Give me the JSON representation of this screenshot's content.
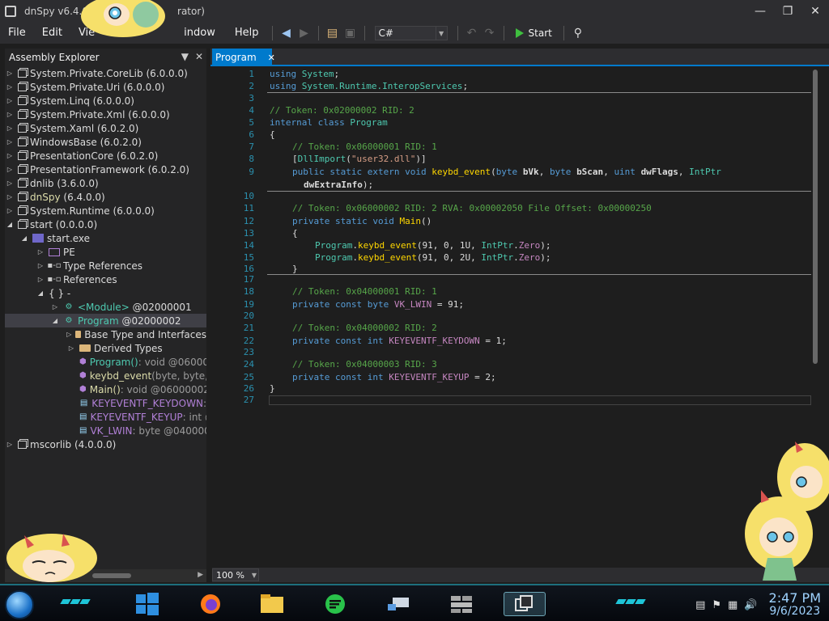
{
  "window": {
    "title_prefix": "dnSpy v6.4.0",
    "title_suffix": "rator)"
  },
  "menu": {
    "file": "File",
    "edit": "Edit",
    "view": "Vie",
    "window": "indow",
    "help": "Help"
  },
  "toolbar": {
    "language": "C#",
    "start_label": "Start"
  },
  "explorer": {
    "title": "Assembly Explorer",
    "tree": {
      "r1": {
        "name": "System.Private.CoreLib",
        "ver": "(6.0.0.0)"
      },
      "r2": {
        "name": "System.Private.Uri",
        "ver": "(6.0.0.0)"
      },
      "r3": {
        "name": "System.Linq",
        "ver": "(6.0.0.0)"
      },
      "r4": {
        "name": "System.Private.Xml",
        "ver": "(6.0.0.0)"
      },
      "r5": {
        "name": "System.Xaml",
        "ver": "(6.0.2.0)"
      },
      "r6": {
        "name": "WindowsBase",
        "ver": "(6.0.2.0)"
      },
      "r7": {
        "name": "PresentationCore",
        "ver": "(6.0.2.0)"
      },
      "r8": {
        "name": "PresentationFramework",
        "ver": "(6.0.2.0)"
      },
      "r9": {
        "name": "dnlib",
        "ver": "(3.6.0.0)"
      },
      "r10": {
        "name": "dnSpy",
        "ver": "(6.4.0.0)"
      },
      "r11": {
        "name": "System.Runtime",
        "ver": "(6.0.0.0)"
      },
      "r12": {
        "name": "start",
        "ver": "(0.0.0.0)"
      },
      "r13": {
        "name": "start.exe"
      },
      "r14": {
        "name": "PE"
      },
      "r15": {
        "name": "Type References"
      },
      "r16": {
        "name": "References"
      },
      "r17": {
        "name": "{ } -"
      },
      "r18": {
        "name": "<Module>",
        "ver": "@02000001"
      },
      "r19": {
        "name": "Program",
        "ver": "@02000002"
      },
      "r20": {
        "name": "Base Type and Interfaces"
      },
      "r21": {
        "name": "Derived Types"
      },
      "r22": {
        "name": "Program()",
        "ver": " : void @060000"
      },
      "r23": {
        "name": "keybd_event",
        "ver": "(byte, byte, u"
      },
      "r24": {
        "name": "Main()",
        "ver": " : void @06000002"
      },
      "r25": {
        "name": "KEYEVENTF_KEYDOWN",
        "ver": " :"
      },
      "r26": {
        "name": "KEYEVENTF_KEYUP",
        "ver": " : int @"
      },
      "r27": {
        "name": "VK_LWIN",
        "ver": " : byte @0400000"
      },
      "r28": {
        "name": "mscorlib",
        "ver": "(4.0.0.0)"
      }
    }
  },
  "editor": {
    "tab_label": "Program",
    "zoom": "100 %",
    "line_numbers": [
      "1",
      "2",
      "3",
      "4",
      "5",
      "6",
      "7",
      "8",
      "9",
      "10",
      "11",
      "12",
      "13",
      "14",
      "15",
      "16",
      "17",
      "18",
      "19",
      "20",
      "21",
      "22",
      "23",
      "24",
      "25",
      "26",
      "27"
    ],
    "code": {
      "l1_kw": "using",
      "l1_ns": "System",
      "l2_kw": "using",
      "l2_ns": "System.Runtime.InteropServices",
      "l4": "// Token: 0x02000002 RID: 2",
      "l5_kw": "internal class",
      "l5_name": "Program",
      "l6": "{",
      "l7": "// Token: 0x06000001 RID: 1",
      "l8_attr": "DllImport",
      "l8_str": "\"user32.dll\"",
      "l9_kw": "public static extern void",
      "l9_name": "keybd_event",
      "l9_t1": "byte",
      "l9_p1": "bVk",
      "l9_t2": "byte",
      "l9_p2": "bScan",
      "l9_t3": "uint",
      "l9_p3": "dwFlags",
      "l9_t4": "IntPtr",
      "l9b": "dwExtraInfo",
      "l11": "// Token: 0x06000002 RID: 2 RVA: 0x00002050 File Offset: 0x00000250",
      "l12_kw": "private static void",
      "l12_name": "Main",
      "l13": "{",
      "l14_cls": "Program",
      "l14_m": "keybd_event",
      "l14_args": "(91, 0, 1U, ",
      "l14_t": "IntPtr",
      "l14_z": "Zero",
      "l15_cls": "Program",
      "l15_m": "keybd_event",
      "l15_args": "(91, 0, 2U, ",
      "l15_t": "IntPtr",
      "l15_z": "Zero",
      "l16": "}",
      "l18": "// Token: 0x04000001 RID: 1",
      "l19_kw": "private const byte",
      "l19_name": "VK_LWIN",
      "l19_val": " = 91;",
      "l21": "// Token: 0x04000002 RID: 2",
      "l22_kw": "private const int",
      "l22_name": "KEYEVENTF_KEYDOWN",
      "l22_val": " = 1;",
      "l24": "// Token: 0x04000003 RID: 3",
      "l25_kw": "private const int",
      "l25_name": "KEYEVENTF_KEYUP",
      "l25_val": " = 2;",
      "l26": "}"
    }
  },
  "taskbar": {
    "time": "2:47 PM",
    "date": "9/6/2023"
  },
  "colors": {
    "accent": "#007acc",
    "comment": "#57a64a",
    "keyword": "#569cd6",
    "type": "#4ec9b0",
    "method": "#ffd700"
  }
}
